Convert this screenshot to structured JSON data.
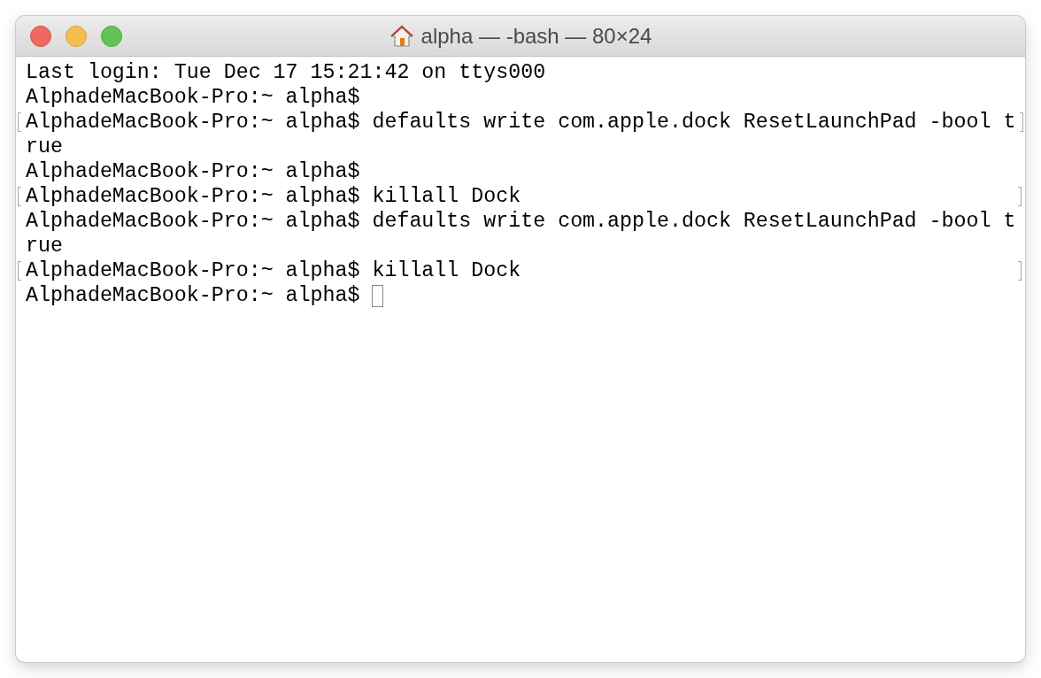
{
  "window": {
    "title": "alpha — -bash — 80×24"
  },
  "lines": [
    {
      "text": "Last login: Tue Dec 17 15:21:42 on ttys000",
      "marked": false,
      "cursor": false
    },
    {
      "text": "AlphadeMacBook-Pro:~ alpha$",
      "marked": false,
      "cursor": false
    },
    {
      "text": "AlphadeMacBook-Pro:~ alpha$ defaults write com.apple.dock ResetLaunchPad -bool t",
      "marked": true,
      "cursor": false
    },
    {
      "text": "rue",
      "marked": false,
      "cursor": false
    },
    {
      "text": "AlphadeMacBook-Pro:~ alpha$",
      "marked": false,
      "cursor": false
    },
    {
      "text": "AlphadeMacBook-Pro:~ alpha$ killall Dock",
      "marked": true,
      "cursor": false
    },
    {
      "text": "AlphadeMacBook-Pro:~ alpha$ defaults write com.apple.dock ResetLaunchPad -bool t",
      "marked": false,
      "cursor": false
    },
    {
      "text": "rue",
      "marked": false,
      "cursor": false
    },
    {
      "text": "AlphadeMacBook-Pro:~ alpha$ killall Dock",
      "marked": true,
      "cursor": false
    },
    {
      "text": "AlphadeMacBook-Pro:~ alpha$",
      "marked": false,
      "cursor": true
    }
  ]
}
